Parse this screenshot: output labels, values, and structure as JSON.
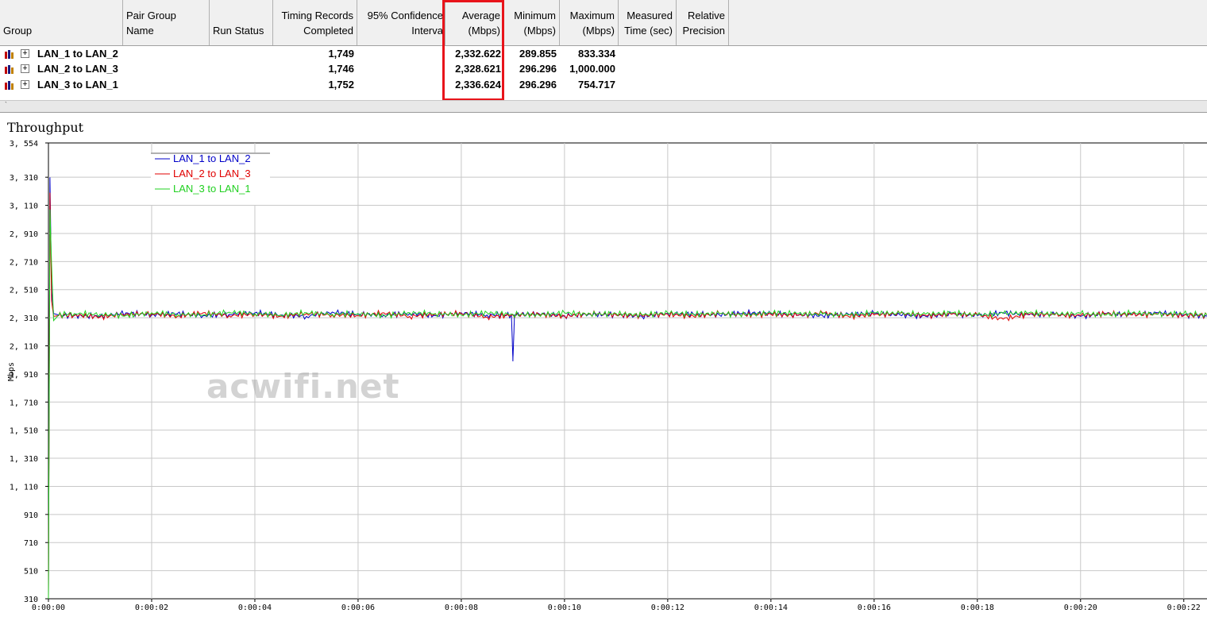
{
  "grid": {
    "columns": [
      {
        "line1": "",
        "line2": "Group"
      },
      {
        "line1": "Pair Group",
        "line2": "Name"
      },
      {
        "line1": "",
        "line2": "Run Status"
      },
      {
        "line1": "Timing Records",
        "line2": "Completed"
      },
      {
        "line1": "95% Confidence",
        "line2": "Interva"
      },
      {
        "line1": "Average",
        "line2": "(Mbps)"
      },
      {
        "line1": "Minimum",
        "line2": "(Mbps)"
      },
      {
        "line1": "Maximum",
        "line2": "(Mbps)"
      },
      {
        "line1": "Measured",
        "line2": "Time (sec)"
      },
      {
        "line1": "Relative",
        "line2": "Precision"
      }
    ],
    "rows": [
      {
        "group": "LAN_1 to LAN_2",
        "records": "1,749",
        "average": "2,332.622",
        "minimum": "289.855",
        "maximum": "833.334"
      },
      {
        "group": "LAN_2 to LAN_3",
        "records": "1,746",
        "average": "2,328.621",
        "minimum": "296.296",
        "maximum": "1,000.000"
      },
      {
        "group": "LAN_3 to LAN_1",
        "records": "1,752",
        "average": "2,336.624",
        "minimum": "296.296",
        "maximum": "754.717"
      }
    ],
    "expander_symbol": "+",
    "highlight_color": "#e8141b"
  },
  "icons": {
    "pair": "pair-chart-icon",
    "expander": "expand-plus-icon"
  },
  "watermark": "acwifi.net",
  "chart_data": {
    "type": "line",
    "title": "Throughput",
    "ylabel": "Mbps",
    "xlabel": "",
    "y_ticks": [
      "3, 554",
      "3, 310",
      "3, 110",
      "2, 910",
      "2, 710",
      "2, 510",
      "2, 310",
      "2, 110",
      "1, 910",
      "1, 710",
      "1, 510",
      "1, 310",
      "1, 110",
      "910",
      "710",
      "510",
      "310"
    ],
    "y_tick_values": [
      3554,
      3310,
      3110,
      2910,
      2710,
      2510,
      2310,
      2110,
      1910,
      1710,
      1510,
      1310,
      1110,
      910,
      710,
      510,
      310
    ],
    "ylim": [
      310,
      3554
    ],
    "x_ticks": [
      "0:00:00",
      "0:00:02",
      "0:00:04",
      "0:00:06",
      "0:00:08",
      "0:00:10",
      "0:00:12",
      "0:00:14",
      "0:00:16",
      "0:00:18",
      "0:00:20",
      "0:00:22"
    ],
    "x_tick_values": [
      0,
      2,
      4,
      6,
      8,
      10,
      12,
      14,
      16,
      18,
      20,
      22
    ],
    "xlim": [
      0,
      22.45
    ],
    "grid": true,
    "legend_position": "top-left",
    "series": [
      {
        "name": "LAN_1 to LAN_2",
        "color": "#0000c8",
        "x": [
          0,
          0.03,
          0.06,
          0.1,
          0.2,
          0.5,
          1,
          1.5,
          2,
          2.5,
          3,
          3.5,
          4,
          4.5,
          5,
          5.5,
          6,
          6.5,
          7,
          7.5,
          8,
          8.5,
          8.97,
          9.0,
          9.03,
          9.5,
          10,
          10.5,
          11,
          11.5,
          12,
          12.5,
          13,
          13.5,
          14,
          14.5,
          15,
          15.5,
          16,
          16.5,
          17,
          17.5,
          18,
          18.5,
          19,
          19.5,
          20,
          20.5,
          21,
          21.5,
          22,
          22.45
        ],
        "y": [
          310,
          3310,
          2510,
          2340,
          2330,
          2325,
          2320,
          2345,
          2330,
          2340,
          2325,
          2335,
          2345,
          2330,
          2320,
          2350,
          2335,
          2330,
          2340,
          2325,
          2345,
          2330,
          2330,
          2000,
          2330,
          2340,
          2325,
          2335,
          2330,
          2320,
          2340,
          2335,
          2330,
          2345,
          2340,
          2330,
          2325,
          2335,
          2340,
          2330,
          2320,
          2335,
          2325,
          2345,
          2330,
          2335,
          2320,
          2340,
          2330,
          2345,
          2330,
          2320
        ]
      },
      {
        "name": "LAN_2 to LAN_3",
        "color": "#e00000",
        "x": [
          0,
          0.03,
          0.06,
          0.1,
          0.2,
          0.5,
          1,
          1.5,
          2,
          2.5,
          3,
          3.5,
          4,
          4.5,
          5,
          5.5,
          6,
          6.5,
          7,
          7.5,
          8,
          8.5,
          9,
          9.5,
          10,
          10.5,
          11,
          11.5,
          12,
          12.5,
          13,
          13.5,
          14,
          14.5,
          15,
          15.5,
          16,
          16.5,
          17,
          17.5,
          18,
          18.5,
          19,
          19.5,
          20,
          20.5,
          21,
          21.5,
          22,
          22.45
        ],
        "y": [
          310,
          3200,
          2430,
          2320,
          2325,
          2330,
          2315,
          2335,
          2340,
          2320,
          2345,
          2325,
          2335,
          2320,
          2340,
          2330,
          2325,
          2345,
          2320,
          2335,
          2340,
          2315,
          2330,
          2335,
          2320,
          2340,
          2330,
          2325,
          2335,
          2320,
          2340,
          2330,
          2335,
          2325,
          2345,
          2320,
          2330,
          2340,
          2325,
          2335,
          2330,
          2300,
          2335,
          2330,
          2325,
          2340,
          2330,
          2335,
          2325,
          2330
        ]
      },
      {
        "name": "LAN_3 to LAN_1",
        "color": "#20d020",
        "x": [
          0,
          0.03,
          0.06,
          0.1,
          0.2,
          0.5,
          1,
          1.5,
          2,
          2.5,
          3,
          3.5,
          4,
          4.5,
          5,
          5.5,
          6,
          6.5,
          7,
          7.5,
          8,
          8.5,
          9,
          9.5,
          10,
          10.5,
          11,
          11.5,
          12,
          12.5,
          13,
          13.5,
          14,
          14.5,
          15,
          15.5,
          16,
          16.5,
          17,
          17.5,
          18,
          18.5,
          19,
          19.5,
          20,
          20.5,
          21,
          21.5,
          22,
          22.45
        ],
        "y": [
          310,
          3080,
          2700,
          2290,
          2330,
          2340,
          2335,
          2325,
          2345,
          2335,
          2330,
          2350,
          2340,
          2330,
          2345,
          2335,
          2340,
          2325,
          2345,
          2340,
          2330,
          2345,
          2335,
          2330,
          2345,
          2335,
          2340,
          2330,
          2345,
          2335,
          2340,
          2330,
          2345,
          2340,
          2335,
          2330,
          2345,
          2340,
          2335,
          2345,
          2330,
          2340,
          2345,
          2335,
          2340,
          2330,
          2345,
          2335,
          2340,
          2330
        ]
      }
    ]
  }
}
